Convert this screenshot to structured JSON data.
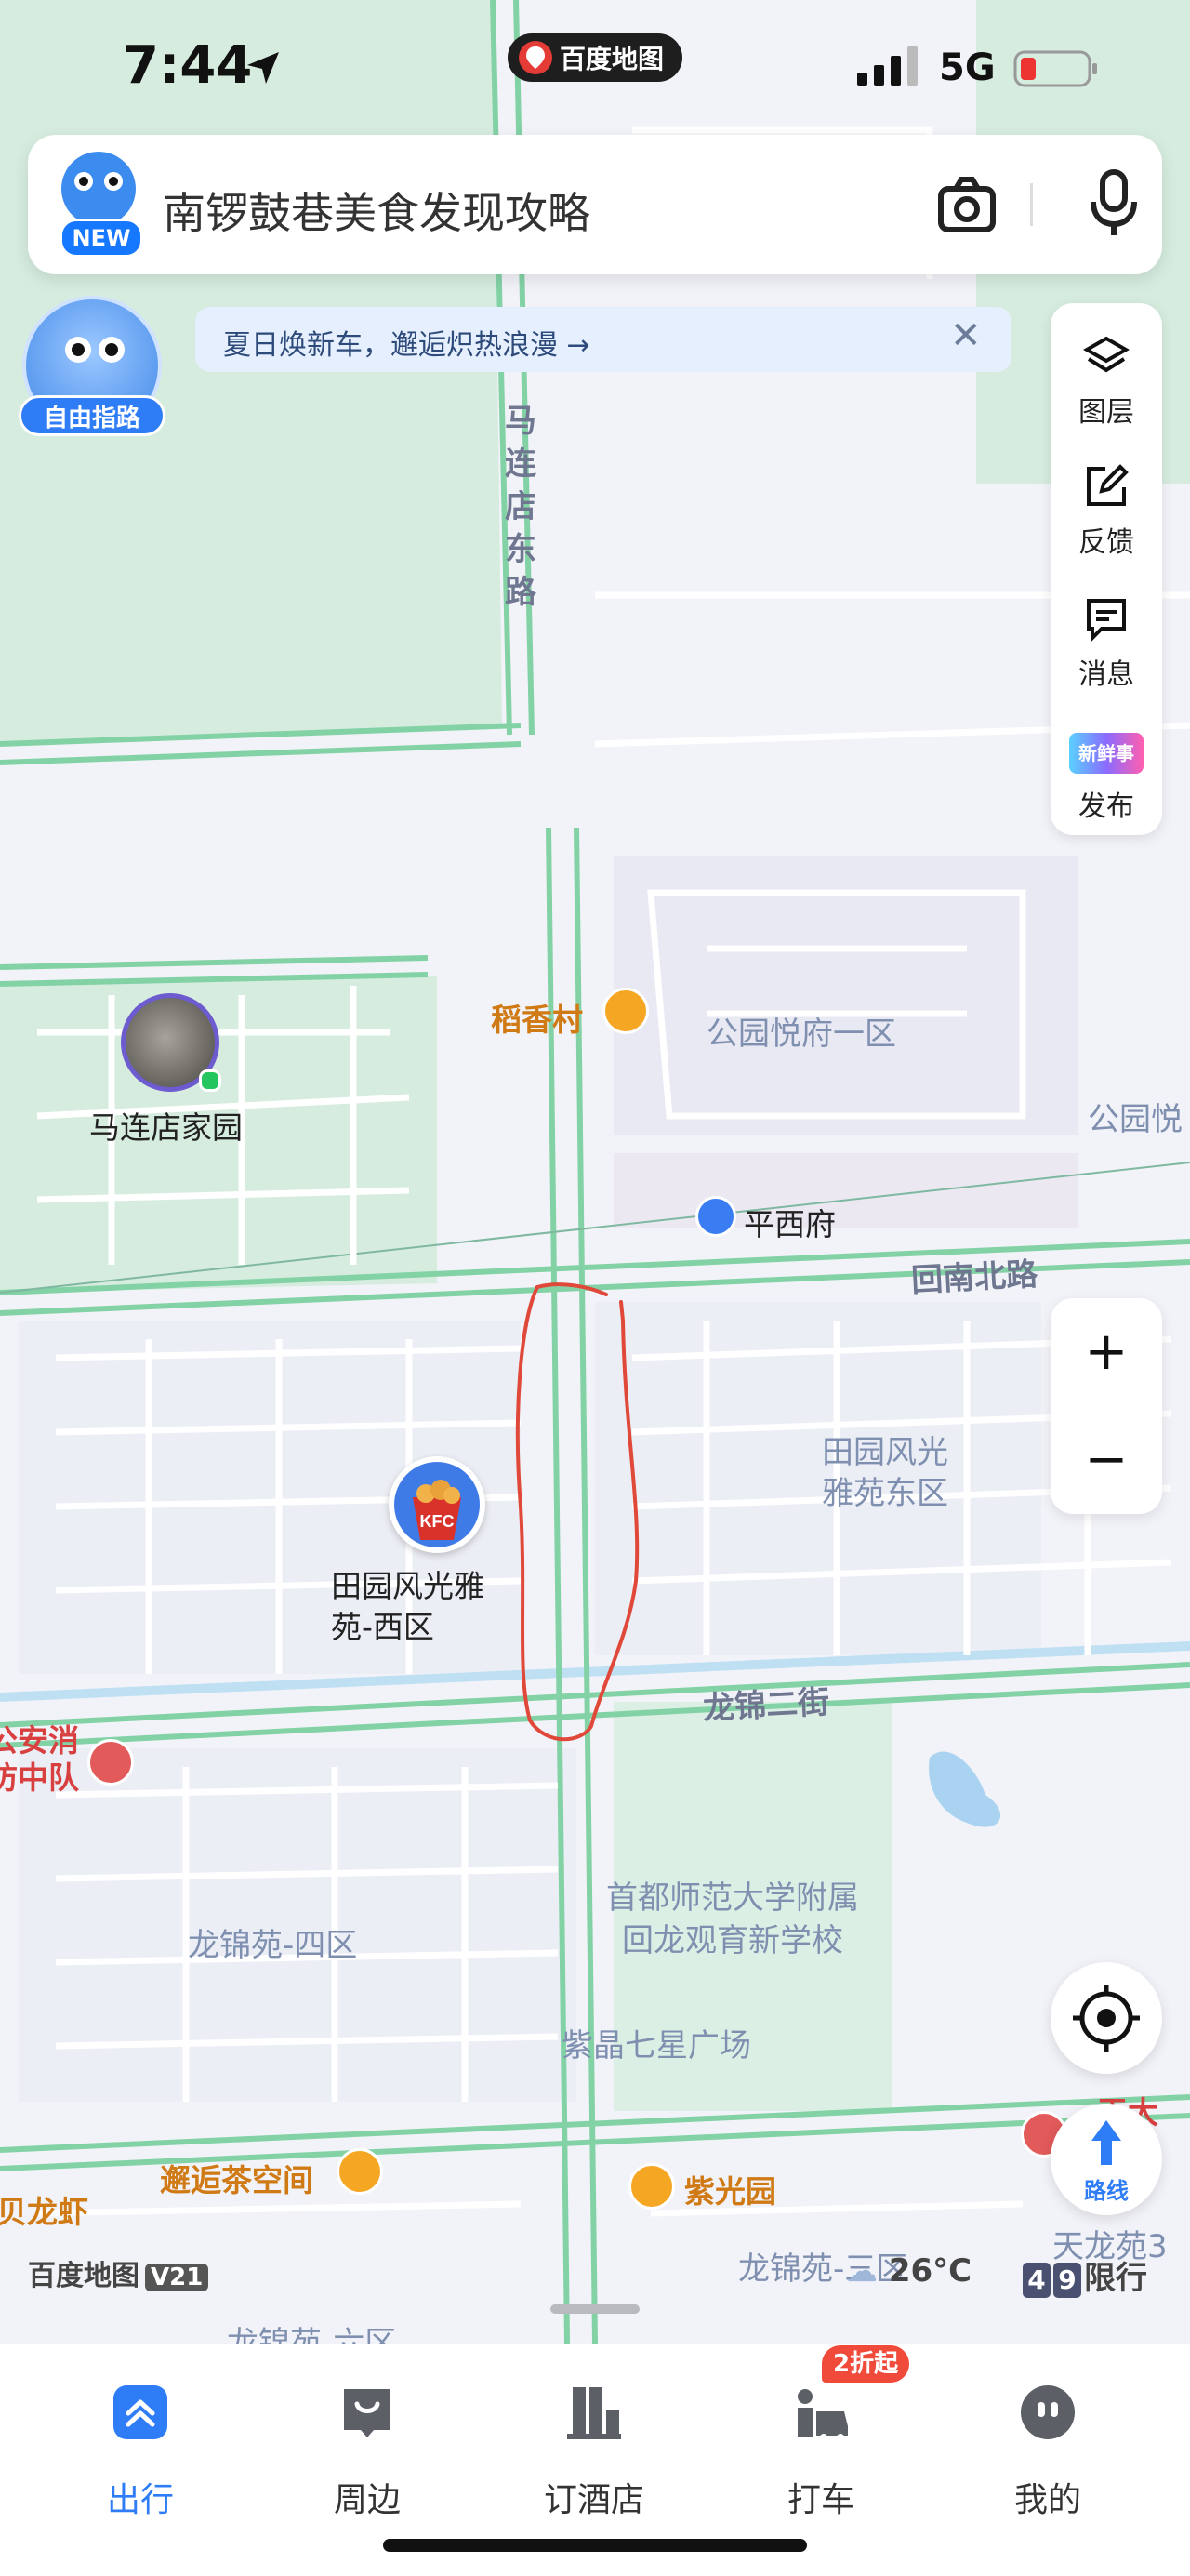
{
  "status_bar": {
    "time": "7:44",
    "app_pill": "百度地图",
    "network": "5G"
  },
  "search": {
    "badge": "NEW",
    "placeholder": "南锣鼓巷美食发现攻略"
  },
  "free_guide": {
    "label": "自由指路"
  },
  "notice": {
    "text": "夏日焕新车，邂逅炽热浪漫 →",
    "close": "✕"
  },
  "side_toolbar": {
    "items": [
      {
        "label": "图层",
        "icon": "layers-icon"
      },
      {
        "label": "反馈",
        "icon": "feedback-icon"
      },
      {
        "label": "消息",
        "icon": "message-icon"
      },
      {
        "label": "发布",
        "icon": "publish-icon",
        "badge": "新鲜事"
      }
    ]
  },
  "zoom": {
    "in": "+",
    "out": "−"
  },
  "route_button": {
    "label": "路线"
  },
  "map": {
    "roads": {
      "ma_lian_dian_east": "马\n连\n店\n东\n路",
      "hui_nan_bei": "回南北路",
      "long_jin_2": "龙锦二街"
    },
    "areas": {
      "gongyuan_yuefu": "公园悦府一区",
      "gongyuan_yue_partial": "公园悦",
      "tianyuan_east": "田园风光\n雅苑东区",
      "tianyuan_west": "田园风光雅\n苑-西区",
      "ma_lian_dian_home": "马连店家园",
      "long_jin_4": "龙锦苑-四区",
      "school": "首都师范大学附属\n回龙观育新学校",
      "zijing": "紫晶七星广场",
      "long_jin_3": "龙锦苑-三区",
      "long_jin_bottom": "龙锦苑-六区",
      "fire": "公安消\n防中队",
      "tianlong": "天龙苑3"
    },
    "pois": {
      "daoxiangcun": "稻香村",
      "pingxifu": "平西府",
      "xiehou": "邂逅茶空间",
      "ziguang": "紫光园",
      "shrimp": "贝龙虾",
      "hospital_partial": "天大\n医院"
    }
  },
  "watermark": {
    "brand": "百度地图",
    "version": "V21"
  },
  "weather": {
    "text": "26°C"
  },
  "traffic_limit": {
    "plates": [
      "4",
      "9"
    ],
    "label": "限行"
  },
  "tab_bar": {
    "items": [
      {
        "label": "出行",
        "icon": "travel-icon",
        "active": true
      },
      {
        "label": "周边",
        "icon": "nearby-icon",
        "active": false
      },
      {
        "label": "订酒店",
        "icon": "hotel-icon",
        "active": false
      },
      {
        "label": "打车",
        "icon": "taxi-icon",
        "active": false
      },
      {
        "label": "我的",
        "icon": "profile-icon",
        "active": false
      }
    ],
    "promo": "2折起"
  },
  "colors": {
    "accent": "#2f7df6",
    "road": "#7ed1a3",
    "park": "#d6ecdf",
    "annotation": "#e0493a"
  }
}
